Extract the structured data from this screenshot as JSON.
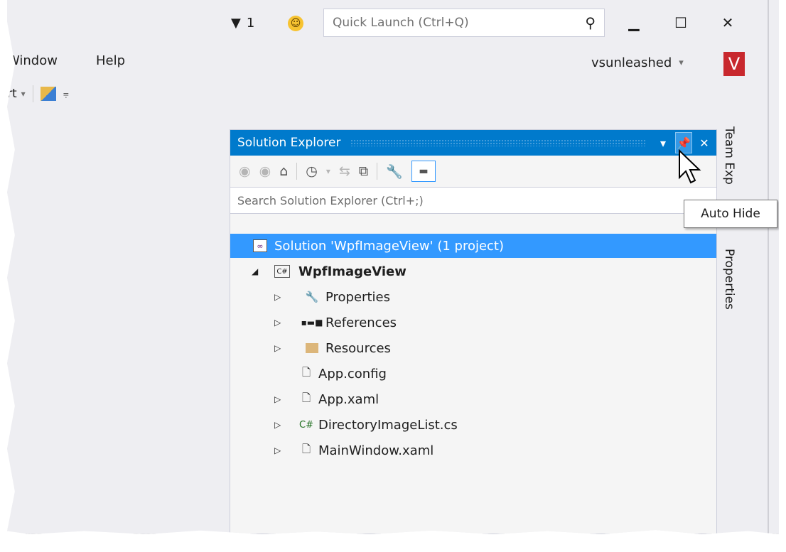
{
  "titlebar": {
    "filter_count": "1",
    "quick_launch_placeholder": "Quick Launch (Ctrl+Q)",
    "minimize": "▁",
    "maximize": "☐",
    "close": "✕"
  },
  "menu": {
    "items": [
      "Window",
      "Help"
    ]
  },
  "account": {
    "name": "vsunleashed",
    "dropdown": "▾",
    "avatar_letter": "V",
    "avatar_color": "#c8282e"
  },
  "toolbar": {
    "start_label": "rt",
    "dropdown": "▾",
    "overflow": "⩦"
  },
  "solution_explorer": {
    "title": "Solution Explorer",
    "search_placeholder": "Search Solution Explorer (Ctrl+;)",
    "title_color": "#007acc",
    "tree": [
      {
        "label": "Solution 'WpfImageView' (1 project)",
        "icon": "solution-icon",
        "level": 0,
        "selected": true
      },
      {
        "label": "WpfImageView",
        "icon": "csharp-project-icon",
        "level": 1,
        "expanded": true
      },
      {
        "label": "Properties",
        "icon": "wrench-icon",
        "level": 2,
        "expandable": true
      },
      {
        "label": "References",
        "icon": "references-icon",
        "level": 2,
        "expandable": true
      },
      {
        "label": "Resources",
        "icon": "folder-icon",
        "level": 2,
        "expandable": true
      },
      {
        "label": "App.config",
        "icon": "config-file-icon",
        "level": 2,
        "expandable": false
      },
      {
        "label": "App.xaml",
        "icon": "xaml-file-icon",
        "level": 2,
        "expandable": true
      },
      {
        "label": "DirectoryImageList.cs",
        "icon": "csharp-file-icon",
        "level": 2,
        "expandable": true
      },
      {
        "label": "MainWindow.xaml",
        "icon": "xaml-file-icon",
        "level": 2,
        "expandable": true
      }
    ]
  },
  "side_tabs": [
    "Team Exp",
    "Properties"
  ],
  "tooltip": "Auto Hide"
}
